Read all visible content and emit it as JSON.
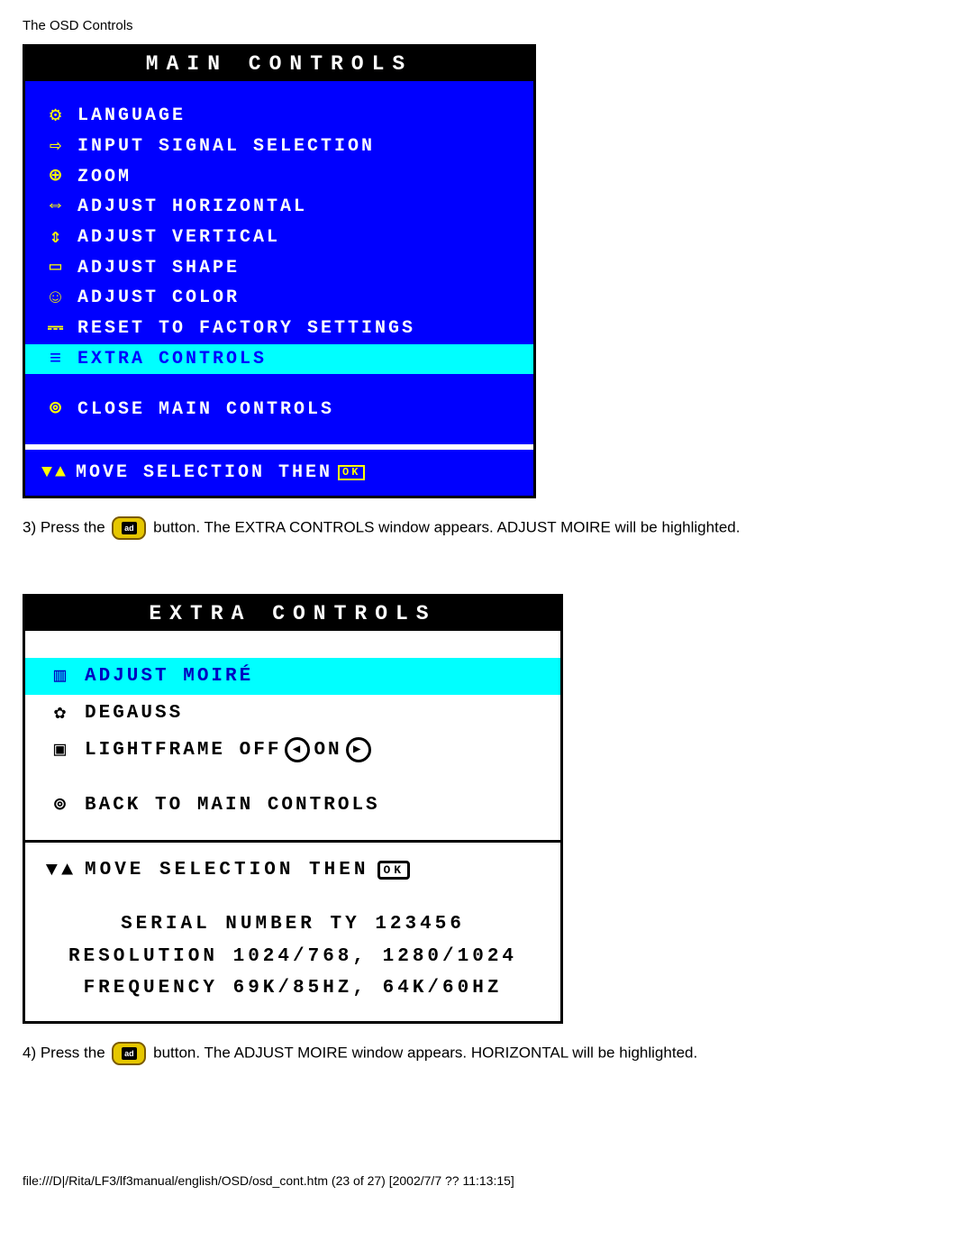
{
  "page": {
    "header": "The OSD Controls",
    "footer_path": "file:///D|/Rita/LF3/lf3manual/english/OSD/osd_cont.htm (23 of 27) [2002/7/7 ?? 11:13:15]"
  },
  "main_controls": {
    "title": "Main Controls",
    "items": [
      {
        "icon": "⚙",
        "label": "Language"
      },
      {
        "icon": "⇨",
        "label": "Input Signal Selection"
      },
      {
        "icon": "⊕",
        "label": "Zoom"
      },
      {
        "icon": "⇔",
        "label": "Adjust Horizontal"
      },
      {
        "icon": "⇕",
        "label": "Adjust Vertical"
      },
      {
        "icon": "▭",
        "label": "Adjust Shape"
      },
      {
        "icon": "☺",
        "label": "Adjust Color"
      },
      {
        "icon": "⎓",
        "label": "Reset To Factory Settings"
      },
      {
        "icon": "≡",
        "label": "Extra Controls",
        "highlight": true
      }
    ],
    "close": {
      "icon": "⊚",
      "label": "Close Main Controls"
    },
    "hint": {
      "icons": "▼▲",
      "label": "Move Selection Then",
      "ok": "OK"
    }
  },
  "step3": {
    "prefix": "3) Press the",
    "btn": "ad",
    "suffix": "button. The EXTRA CONTROLS window appears. ADJUST MOIRE will be highlighted."
  },
  "extra_controls": {
    "title": "Extra Controls",
    "items": [
      {
        "icon": "▥",
        "label": "Adjust Moiré",
        "highlight": true
      },
      {
        "icon": "✿",
        "label": "Degauss"
      },
      {
        "icon": "▣",
        "label_prefix": "Lightframe",
        "off": "Off",
        "on": "On"
      }
    ],
    "back": {
      "icon": "⊚",
      "label": "Back To Main Controls"
    },
    "hint": {
      "icons": "▼▲",
      "label": "Move Selection Then",
      "ok": "OK"
    },
    "serial_label": "Serial Number TY",
    "serial_value": "123456",
    "resolution_label": "Resolution",
    "resolution_value": "1024/768, 1280/1024",
    "frequency_label": "Frequency",
    "frequency_value": "69K/85Hz, 64K/60Hz"
  },
  "step4": {
    "prefix": "4) Press the",
    "btn": "ad",
    "suffix": "button. The ADJUST MOIRE window appears. HORIZONTAL will be highlighted."
  }
}
